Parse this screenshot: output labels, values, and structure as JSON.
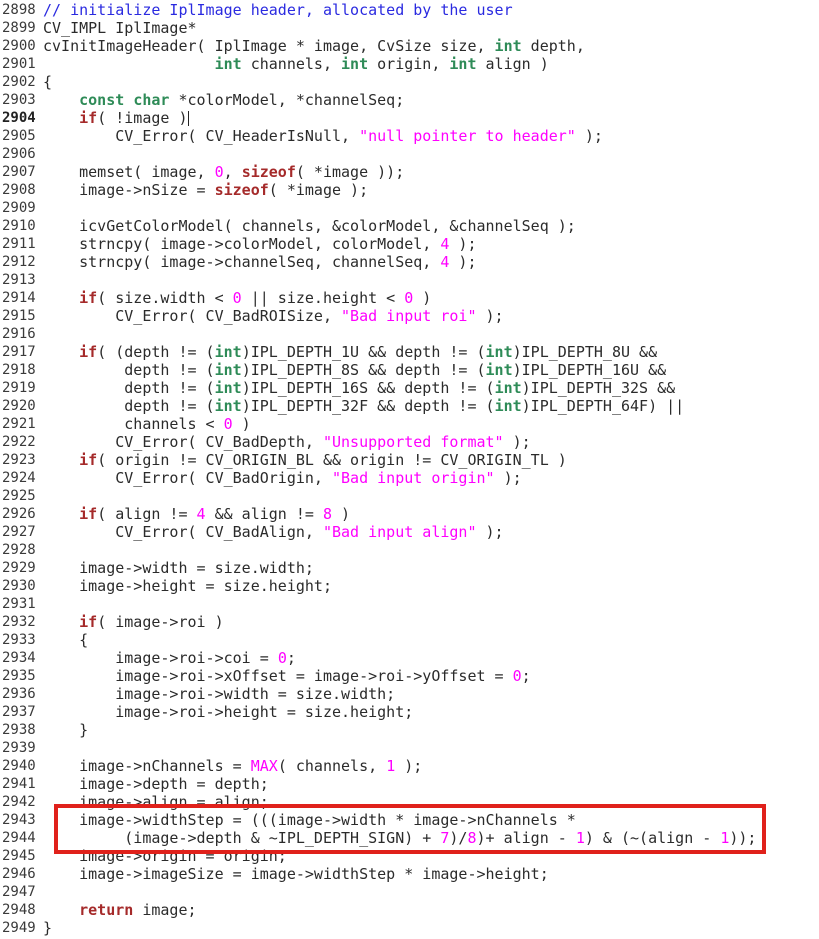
{
  "editor": {
    "current_line": 2904,
    "highlight_box": {
      "color": "#e0211b",
      "lines": [
        2943,
        2944
      ]
    },
    "colors": {
      "comment": "#2a2ae0",
      "type_keyword": "#2e8b57",
      "statement_keyword": "#a52a2a",
      "literal": "#ff00ff"
    },
    "lines": [
      {
        "num": "2898",
        "tokens": [
          [
            "c",
            "// initialize IplImage header, allocated by the user"
          ]
        ]
      },
      {
        "num": "2899",
        "tokens": [
          [
            "p",
            "CV_IMPL IplImage*"
          ]
        ]
      },
      {
        "num": "2900",
        "tokens": [
          [
            "p",
            "cvInitImageHeader( IplImage * image, CvSize size, "
          ],
          [
            "k",
            "int"
          ],
          [
            "p",
            " depth,"
          ]
        ]
      },
      {
        "num": "2901",
        "tokens": [
          [
            "p",
            "                   "
          ],
          [
            "k",
            "int"
          ],
          [
            "p",
            " channels, "
          ],
          [
            "k",
            "int"
          ],
          [
            "p",
            " origin, "
          ],
          [
            "k",
            "int"
          ],
          [
            "p",
            " align )"
          ]
        ]
      },
      {
        "num": "2902",
        "tokens": [
          [
            "p",
            "{"
          ]
        ]
      },
      {
        "num": "2903",
        "tokens": [
          [
            "p",
            "    "
          ],
          [
            "k",
            "const"
          ],
          [
            "p",
            " "
          ],
          [
            "k",
            "char"
          ],
          [
            "p",
            " *colorModel, *channelSeq;"
          ]
        ]
      },
      {
        "num": "2904",
        "tokens": [
          [
            "p",
            "    "
          ],
          [
            "s",
            "if"
          ],
          [
            "p",
            "( !image )"
          ]
        ]
      },
      {
        "num": "2905",
        "tokens": [
          [
            "p",
            "        CV_Error( CV_HeaderIsNull, "
          ],
          [
            "str",
            "\"null pointer to header\""
          ],
          [
            "p",
            " );"
          ]
        ]
      },
      {
        "num": "2906",
        "tokens": []
      },
      {
        "num": "2907",
        "tokens": [
          [
            "p",
            "    memset( image, "
          ],
          [
            "n",
            "0"
          ],
          [
            "p",
            ", "
          ],
          [
            "s",
            "sizeof"
          ],
          [
            "p",
            "( *image ));"
          ]
        ]
      },
      {
        "num": "2908",
        "tokens": [
          [
            "p",
            "    image->nSize = "
          ],
          [
            "s",
            "sizeof"
          ],
          [
            "p",
            "( *image );"
          ]
        ]
      },
      {
        "num": "2909",
        "tokens": []
      },
      {
        "num": "2910",
        "tokens": [
          [
            "p",
            "    icvGetColorModel( channels, &colorModel, &channelSeq );"
          ]
        ]
      },
      {
        "num": "2911",
        "tokens": [
          [
            "p",
            "    strncpy( image->colorModel, colorModel, "
          ],
          [
            "n",
            "4"
          ],
          [
            "p",
            " );"
          ]
        ]
      },
      {
        "num": "2912",
        "tokens": [
          [
            "p",
            "    strncpy( image->channelSeq, channelSeq, "
          ],
          [
            "n",
            "4"
          ],
          [
            "p",
            " );"
          ]
        ]
      },
      {
        "num": "2913",
        "tokens": []
      },
      {
        "num": "2914",
        "tokens": [
          [
            "p",
            "    "
          ],
          [
            "s",
            "if"
          ],
          [
            "p",
            "( size.width < "
          ],
          [
            "n",
            "0"
          ],
          [
            "p",
            " || size.height < "
          ],
          [
            "n",
            "0"
          ],
          [
            "p",
            " )"
          ]
        ]
      },
      {
        "num": "2915",
        "tokens": [
          [
            "p",
            "        CV_Error( CV_BadROISize, "
          ],
          [
            "str",
            "\"Bad input roi\""
          ],
          [
            "p",
            " );"
          ]
        ]
      },
      {
        "num": "2916",
        "tokens": []
      },
      {
        "num": "2917",
        "tokens": [
          [
            "p",
            "    "
          ],
          [
            "s",
            "if"
          ],
          [
            "p",
            "( (depth != ("
          ],
          [
            "k",
            "int"
          ],
          [
            "p",
            ")IPL_DEPTH_1U && depth != ("
          ],
          [
            "k",
            "int"
          ],
          [
            "p",
            ")IPL_DEPTH_8U &&"
          ]
        ]
      },
      {
        "num": "2918",
        "tokens": [
          [
            "p",
            "         depth != ("
          ],
          [
            "k",
            "int"
          ],
          [
            "p",
            ")IPL_DEPTH_8S && depth != ("
          ],
          [
            "k",
            "int"
          ],
          [
            "p",
            ")IPL_DEPTH_16U &&"
          ]
        ]
      },
      {
        "num": "2919",
        "tokens": [
          [
            "p",
            "         depth != ("
          ],
          [
            "k",
            "int"
          ],
          [
            "p",
            ")IPL_DEPTH_16S && depth != ("
          ],
          [
            "k",
            "int"
          ],
          [
            "p",
            ")IPL_DEPTH_32S &&"
          ]
        ]
      },
      {
        "num": "2920",
        "tokens": [
          [
            "p",
            "         depth != ("
          ],
          [
            "k",
            "int"
          ],
          [
            "p",
            ")IPL_DEPTH_32F && depth != ("
          ],
          [
            "k",
            "int"
          ],
          [
            "p",
            ")IPL_DEPTH_64F) ||"
          ]
        ]
      },
      {
        "num": "2921",
        "tokens": [
          [
            "p",
            "         channels < "
          ],
          [
            "n",
            "0"
          ],
          [
            "p",
            " )"
          ]
        ]
      },
      {
        "num": "2922",
        "tokens": [
          [
            "p",
            "        CV_Error( CV_BadDepth, "
          ],
          [
            "str",
            "\"Unsupported format\""
          ],
          [
            "p",
            " );"
          ]
        ]
      },
      {
        "num": "2923",
        "tokens": [
          [
            "p",
            "    "
          ],
          [
            "s",
            "if"
          ],
          [
            "p",
            "( origin != CV_ORIGIN_BL && origin != CV_ORIGIN_TL )"
          ]
        ]
      },
      {
        "num": "2924",
        "tokens": [
          [
            "p",
            "        CV_Error( CV_BadOrigin, "
          ],
          [
            "str",
            "\"Bad input origin\""
          ],
          [
            "p",
            " );"
          ]
        ]
      },
      {
        "num": "2925",
        "tokens": []
      },
      {
        "num": "2926",
        "tokens": [
          [
            "p",
            "    "
          ],
          [
            "s",
            "if"
          ],
          [
            "p",
            "( align != "
          ],
          [
            "n",
            "4"
          ],
          [
            "p",
            " && align != "
          ],
          [
            "n",
            "8"
          ],
          [
            "p",
            " )"
          ]
        ]
      },
      {
        "num": "2927",
        "tokens": [
          [
            "p",
            "        CV_Error( CV_BadAlign, "
          ],
          [
            "str",
            "\"Bad input align\""
          ],
          [
            "p",
            " );"
          ]
        ]
      },
      {
        "num": "2928",
        "tokens": []
      },
      {
        "num": "2929",
        "tokens": [
          [
            "p",
            "    image->width = size.width;"
          ]
        ]
      },
      {
        "num": "2930",
        "tokens": [
          [
            "p",
            "    image->height = size.height;"
          ]
        ]
      },
      {
        "num": "2931",
        "tokens": []
      },
      {
        "num": "2932",
        "tokens": [
          [
            "p",
            "    "
          ],
          [
            "s",
            "if"
          ],
          [
            "p",
            "( image->roi )"
          ]
        ]
      },
      {
        "num": "2933",
        "tokens": [
          [
            "p",
            "    {"
          ]
        ]
      },
      {
        "num": "2934",
        "tokens": [
          [
            "p",
            "        image->roi->coi = "
          ],
          [
            "n",
            "0"
          ],
          [
            "p",
            ";"
          ]
        ]
      },
      {
        "num": "2935",
        "tokens": [
          [
            "p",
            "        image->roi->xOffset = image->roi->yOffset = "
          ],
          [
            "n",
            "0"
          ],
          [
            "p",
            ";"
          ]
        ]
      },
      {
        "num": "2936",
        "tokens": [
          [
            "p",
            "        image->roi->width = size.width;"
          ]
        ]
      },
      {
        "num": "2937",
        "tokens": [
          [
            "p",
            "        image->roi->height = size.height;"
          ]
        ]
      },
      {
        "num": "2938",
        "tokens": [
          [
            "p",
            "    }"
          ]
        ]
      },
      {
        "num": "2939",
        "tokens": []
      },
      {
        "num": "2940",
        "tokens": [
          [
            "p",
            "    image->nChannels = "
          ],
          [
            "m",
            "MAX"
          ],
          [
            "p",
            "( channels, "
          ],
          [
            "n",
            "1"
          ],
          [
            "p",
            " );"
          ]
        ]
      },
      {
        "num": "2941",
        "tokens": [
          [
            "p",
            "    image->depth = depth;"
          ]
        ]
      },
      {
        "num": "2942",
        "tokens": [
          [
            "p",
            "    image->align = align;"
          ]
        ]
      },
      {
        "num": "2943",
        "tokens": [
          [
            "p",
            "    image->widthStep = (((image->width * image->nChannels *"
          ]
        ]
      },
      {
        "num": "2944",
        "tokens": [
          [
            "p",
            "         (image->depth & ~IPL_DEPTH_SIGN) + "
          ],
          [
            "n",
            "7"
          ],
          [
            "p",
            ")/"
          ],
          [
            "n",
            "8"
          ],
          [
            "p",
            ")+ align - "
          ],
          [
            "n",
            "1"
          ],
          [
            "p",
            ") & (~(align - "
          ],
          [
            "n",
            "1"
          ],
          [
            "p",
            "));"
          ]
        ]
      },
      {
        "num": "2945",
        "tokens": [
          [
            "p",
            "    image->origin = origin;"
          ]
        ]
      },
      {
        "num": "2946",
        "tokens": [
          [
            "p",
            "    image->imageSize = image->widthStep * image->height;"
          ]
        ]
      },
      {
        "num": "2947",
        "tokens": []
      },
      {
        "num": "2948",
        "tokens": [
          [
            "p",
            "    "
          ],
          [
            "s",
            "return"
          ],
          [
            "p",
            " image;"
          ]
        ]
      },
      {
        "num": "2949",
        "tokens": [
          [
            "p",
            "}"
          ]
        ]
      }
    ]
  }
}
